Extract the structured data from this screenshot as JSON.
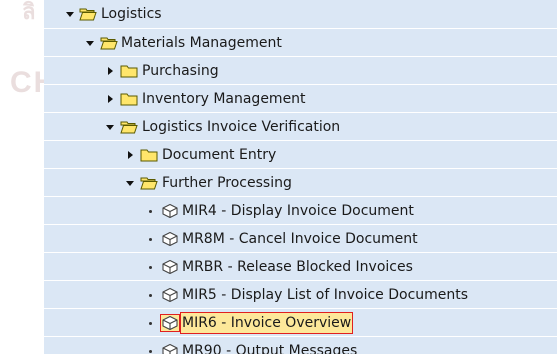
{
  "tree": {
    "logistics": {
      "label": "Logistics",
      "icon": "folder-open-icon"
    },
    "materials_management": {
      "label": "Materials Management",
      "icon": "folder-open-icon"
    },
    "purchasing": {
      "label": "Purchasing",
      "icon": "folder-closed-icon"
    },
    "inventory_management": {
      "label": "Inventory Management",
      "icon": "folder-closed-icon"
    },
    "logistics_invoice_verification": {
      "label": "Logistics Invoice Verification",
      "icon": "folder-open-icon"
    },
    "document_entry": {
      "label": "Document Entry",
      "icon": "folder-closed-icon"
    },
    "further_processing": {
      "label": "Further Processing",
      "icon": "folder-open-icon"
    },
    "transactions": [
      {
        "label": "MIR4 - Display Invoice Document",
        "icon": "transaction-cube-icon"
      },
      {
        "label": "MR8M - Cancel Invoice Document",
        "icon": "transaction-cube-icon"
      },
      {
        "label": "MRBR - Release Blocked Invoices",
        "icon": "transaction-cube-icon"
      },
      {
        "label": "MIR5 - Display List of Invoice Documents",
        "icon": "transaction-cube-icon"
      },
      {
        "label": "MIR6 - Invoice Overview",
        "icon": "transaction-cube-icon",
        "selected": true
      },
      {
        "label": "MR90 - Output Messages",
        "icon": "transaction-cube-icon"
      }
    ]
  },
  "colors": {
    "tree_background": "#dbe7f5",
    "folder_fill": "#ffe66b",
    "folder_outline": "#5a5a00",
    "selection_fill": "#fde89a",
    "selection_border": "#e02020"
  }
}
